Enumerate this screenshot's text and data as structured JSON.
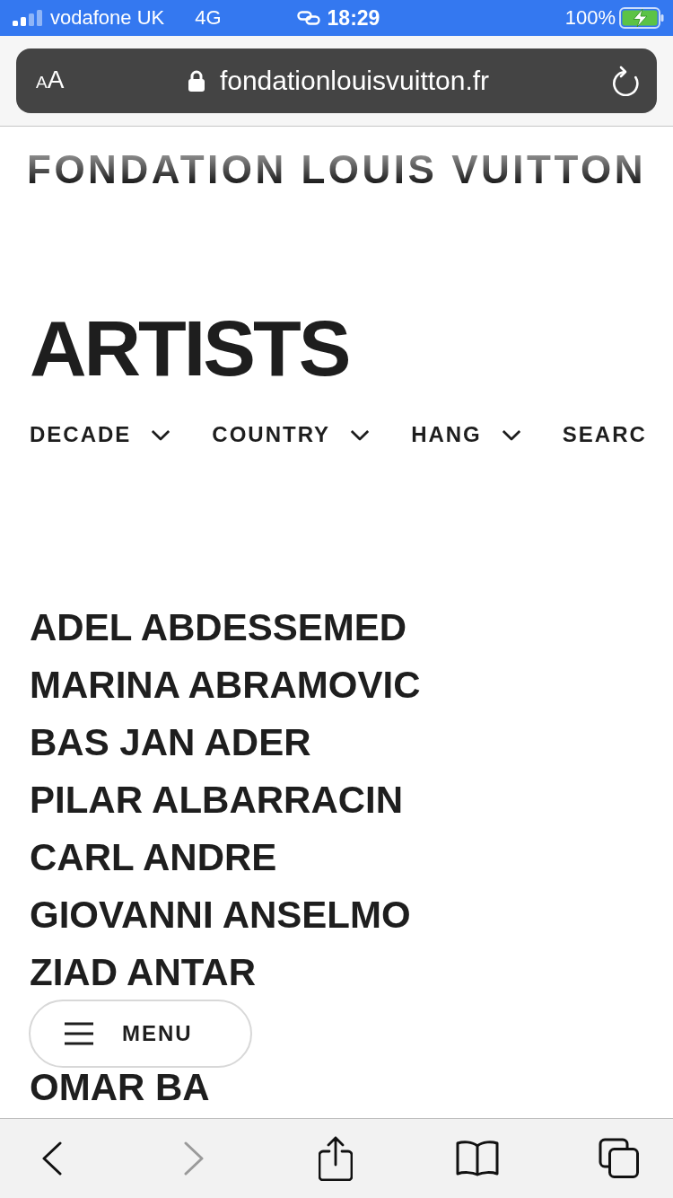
{
  "status_bar": {
    "carrier": "vodafone UK",
    "network": "4G",
    "time": "18:29",
    "battery": "100%",
    "charging": true
  },
  "browser": {
    "text_size_button": "AA",
    "url": "fondationlouisvuitton.fr",
    "secure": true
  },
  "logo": "FONDATION LOUIS VUITTON",
  "page_title": "ARTISTS",
  "filters": [
    {
      "label": "DECADE",
      "kind": "dropdown"
    },
    {
      "label": "COUNTRY",
      "kind": "dropdown"
    },
    {
      "label": "HANG",
      "kind": "dropdown"
    },
    {
      "label": "SEARC",
      "kind": "link"
    }
  ],
  "artists": [
    "ADEL ABDESSEMED",
    "MARINA ABRAMOVIC",
    "BAS JAN ADER",
    "PILAR ALBARRACIN",
    "CARL ANDRE",
    "GIOVANNI ANSELMO",
    "ZIAD ANTAR"
  ],
  "menu_button": {
    "label": "MENU"
  },
  "artists_after_menu": [
    "OMAR BA"
  ],
  "toolbar": [
    {
      "kind": "back",
      "disabled": false
    },
    {
      "kind": "forward",
      "disabled": true
    },
    {
      "kind": "share",
      "disabled": false
    },
    {
      "kind": "bookmarks",
      "disabled": false
    },
    {
      "kind": "tabs",
      "disabled": false
    }
  ]
}
